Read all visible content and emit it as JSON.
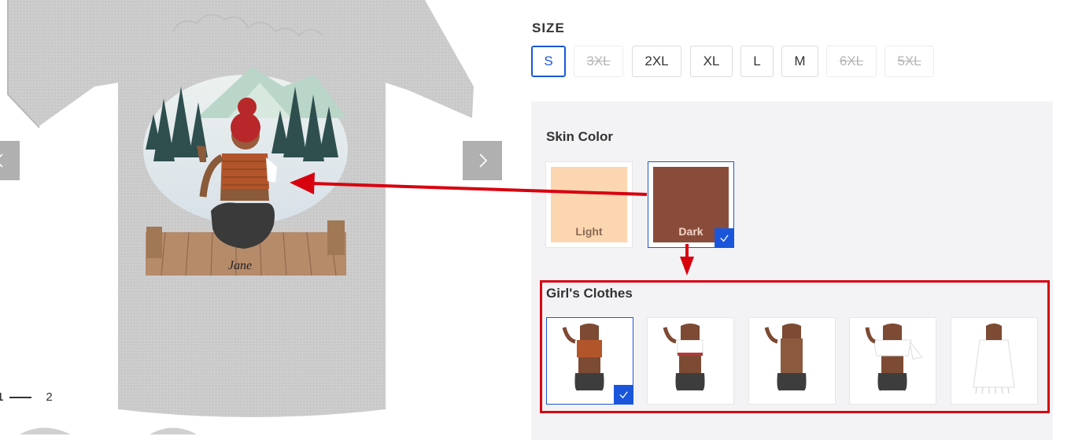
{
  "gallery": {
    "shirt_name_text": "Jane",
    "pager": {
      "current": "1",
      "total": "2"
    },
    "prev_icon": "chevron-left-icon",
    "next_icon": "chevron-right-icon"
  },
  "size": {
    "label": "SIZE",
    "options": [
      {
        "label": "S",
        "state": "selected"
      },
      {
        "label": "3XL",
        "state": "unavailable"
      },
      {
        "label": "2XL",
        "state": "available"
      },
      {
        "label": "XL",
        "state": "available"
      },
      {
        "label": "L",
        "state": "available"
      },
      {
        "label": "M",
        "state": "available"
      },
      {
        "label": "6XL",
        "state": "unavailable"
      },
      {
        "label": "5XL",
        "state": "unavailable"
      }
    ]
  },
  "skin_color": {
    "title": "Skin Color",
    "options": [
      {
        "label": "Light",
        "color": "#fcd6b0",
        "selected": false
      },
      {
        "label": "Dark",
        "color": "#8a4c3a",
        "selected": true
      }
    ]
  },
  "girls_clothes": {
    "title": "Girl's Clothes",
    "options": [
      {
        "style": "brown-crop-top",
        "selected": true
      },
      {
        "style": "white-bandeau-top",
        "selected": false
      },
      {
        "style": "brown-tank-top",
        "selected": false
      },
      {
        "style": "white-off-shoulder-top",
        "selected": false
      },
      {
        "style": "white-fringe-dress",
        "selected": false
      }
    ]
  },
  "colors": {
    "accent": "#1a56db",
    "annotation_red": "#d7000f",
    "panel_bg": "#f3f3f6",
    "shirt_gray": "#cfcfcf"
  }
}
